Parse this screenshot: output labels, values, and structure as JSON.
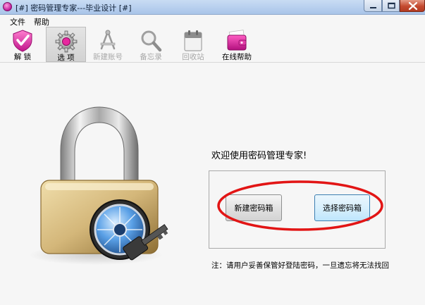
{
  "window": {
    "title": "[#] 密码管理专家---毕业设计 [#]"
  },
  "menu": {
    "items": [
      {
        "label": "文件"
      },
      {
        "label": "帮助"
      }
    ]
  },
  "toolbar": {
    "unlock_label": "解 锁",
    "options_label": "选 项",
    "new_account_label": "新建账号",
    "memo_label": "备忘录",
    "recycle_label": "回收站",
    "online_help_label": "在线帮助"
  },
  "main": {
    "welcome": "欢迎使用密码管理专家!",
    "new_vault_button": "新建密码箱",
    "select_vault_button": "选择密码箱",
    "note": "注：请用户妥善保管好登陆密码，一旦遗忘将无法找回"
  },
  "colors": {
    "annotation_ellipse": "#e21515",
    "accent_pink": "#d6249b"
  }
}
